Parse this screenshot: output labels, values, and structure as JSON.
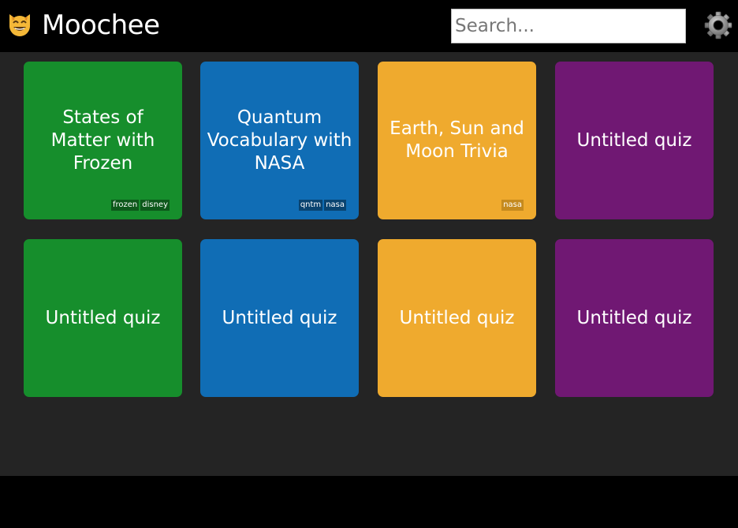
{
  "header": {
    "logo_icon": "grinning-cat-icon",
    "app_title": "Moochee",
    "search_placeholder": "Search...",
    "settings_icon": "gear-icon"
  },
  "quizzes": [
    {
      "title": "States of Matter with Frozen",
      "color": "#168e2c",
      "tags": [
        "frozen",
        "disney"
      ]
    },
    {
      "title": "Quantum Vocabulary with NASA",
      "color": "#106db5",
      "tags": [
        "qntm",
        "nasa"
      ]
    },
    {
      "title": "Earth, Sun and Moon Trivia",
      "color": "#efaa2e",
      "tags": [
        "nasa"
      ]
    },
    {
      "title": "Untitled quiz",
      "color": "#701873",
      "tags": []
    },
    {
      "title": "Untitled quiz",
      "color": "#168e2c",
      "tags": []
    },
    {
      "title": "Untitled quiz",
      "color": "#106db5",
      "tags": []
    },
    {
      "title": "Untitled quiz",
      "color": "#efaa2e",
      "tags": []
    },
    {
      "title": "Untitled quiz",
      "color": "#701873",
      "tags": []
    }
  ]
}
